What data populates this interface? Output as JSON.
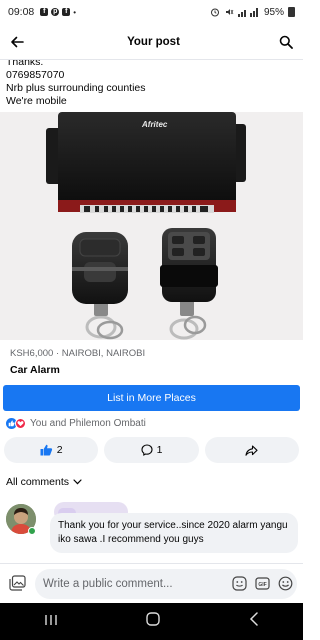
{
  "status_bar": {
    "time": "09:08",
    "battery": "95%",
    "app_icons": [
      "facebook-icon",
      "pinterest-icon",
      "facebook-icon"
    ]
  },
  "app_bar": {
    "title": "Your post",
    "back_icon": "back-arrow-icon",
    "search_icon": "search-icon"
  },
  "post": {
    "lines": [
      "Thanks.",
      "0769857070",
      "Nrb plus surrounding counties",
      "We're mobile"
    ]
  },
  "photo": {
    "brand_text": "Afritec"
  },
  "listing": {
    "meta": "KSH6,000 · NAIROBI, NAIROBI",
    "title": "Car Alarm"
  },
  "list_button": {
    "label": "List in More Places"
  },
  "reactions": {
    "text": "You and Philemon Ombati"
  },
  "actions": {
    "like_count": "2",
    "comment_count": "1"
  },
  "comments_header": {
    "label": "All comments"
  },
  "comment": {
    "text": "Thank you for your service..since 2020 alarm yangu iko sawa .I recommend you guys"
  },
  "composer": {
    "placeholder": "Write a public comment..."
  },
  "colors": {
    "accent": "#1877f2",
    "love": "#f02849",
    "online": "#31a24c",
    "bubble": "#f0f2f5"
  }
}
